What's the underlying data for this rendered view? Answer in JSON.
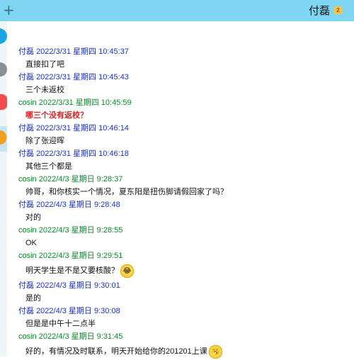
{
  "window": {
    "add_icon": "plus-icon",
    "contact_name": "付磊",
    "contact_icon_glyph": "2"
  },
  "messages": [
    {
      "sender": "付磊",
      "time": "2022/3/31 星期四 10:45:37",
      "text": "直接扣了吧",
      "sender_color": "#1a2fd6"
    },
    {
      "sender": "付磊",
      "time": "2022/3/31 星期四 10:45:43",
      "text": "三个未返校",
      "sender_color": "#1a2fd6"
    },
    {
      "sender": "cosin",
      "time": "2022/3/31 星期四 10:45:59",
      "text": "哪三个没有返校？",
      "sender_color": "#0a8a2a",
      "text_color": "#e02020"
    },
    {
      "sender": "付磊",
      "time": "2022/3/31 星期四 10:46:14",
      "text": "除了张迎晖",
      "sender_color": "#1a2fd6"
    },
    {
      "sender": "付磊",
      "time": "2022/3/31 星期四 10:46:18",
      "text": "其他三个都是",
      "sender_color": "#1a2fd6"
    },
    {
      "sender": "cosin",
      "time": "2022/4/3 星期日 9:28:37",
      "text": "帅哥，和你核实一个情况，夏东阳是扭伤脚请假回家了吗？",
      "sender_color": "#0a8a2a"
    },
    {
      "sender": "付磊",
      "time": "2022/4/3 星期日 9:28:48",
      "text": "对的",
      "sender_color": "#1a2fd6"
    },
    {
      "sender": "cosin",
      "time": "2022/4/3 星期日 9:28:55",
      "text": "OK",
      "sender_color": "#0a8a2a"
    },
    {
      "sender": "cosin",
      "time": "2022/4/3 星期日 9:29:51",
      "text": "明天学生是不是又要核酸？",
      "sender_color": "#0a8a2a",
      "emoji": "😂"
    },
    {
      "sender": "付磊",
      "time": "2022/4/3 星期日 9:30:01",
      "text": "是的",
      "sender_color": "#1a2fd6"
    },
    {
      "sender": "付磊",
      "time": "2022/4/3 星期日 9:30:08",
      "text": "但是是中午十二点半",
      "sender_color": "#1a2fd6"
    },
    {
      "sender": "cosin",
      "time": "2022/4/3 星期日 9:31:45",
      "text": "好的，有情况及时联系，明天开始给你的201201上课",
      "sender_color": "#0a8a2a",
      "emoji": "🥱"
    }
  ]
}
